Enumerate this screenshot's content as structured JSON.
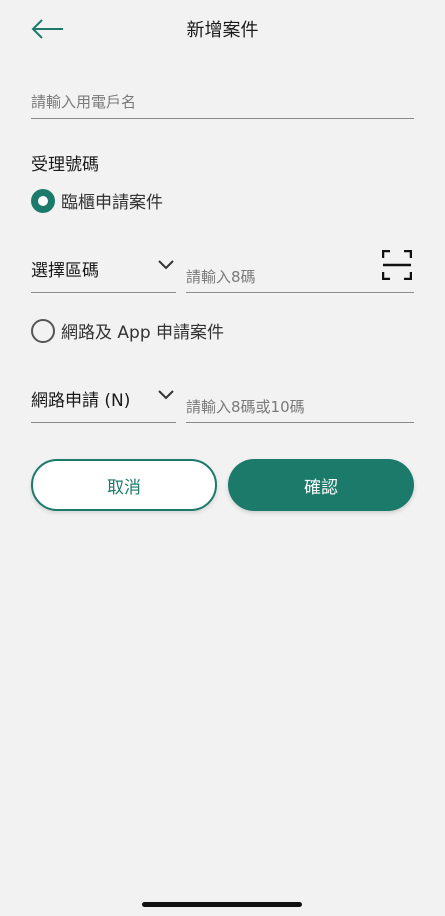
{
  "header": {
    "title": "新增案件",
    "back_icon": "arrow-left-icon"
  },
  "form": {
    "name_placeholder": "請輸入用電戶名",
    "section_title": "受理號碼",
    "option_counter": {
      "label": "臨櫃申請案件",
      "selected": true
    },
    "area_select": {
      "value": "選擇區碼"
    },
    "code8_placeholder": "請輸入8碼",
    "option_online": {
      "label": "網路及 App 申請案件",
      "selected": false
    },
    "net_select": {
      "value": "網路申請 (N)"
    },
    "code10_placeholder": "請輸入8碼或10碼"
  },
  "buttons": {
    "cancel": "取消",
    "confirm": "確認"
  },
  "colors": {
    "accent": "#1c7a6b",
    "background": "#f2f2f2"
  }
}
